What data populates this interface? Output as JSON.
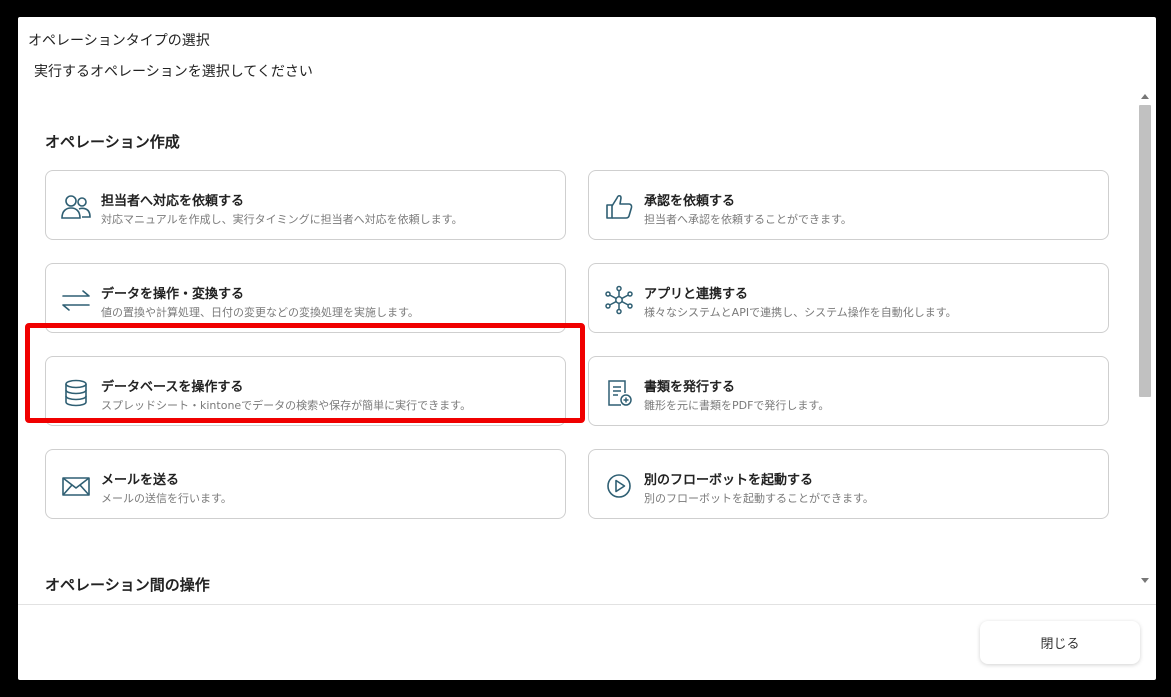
{
  "dialog": {
    "title": "オペレーションタイプの選択",
    "subtitle": "実行するオペレーションを選択してください",
    "close_label": "閉じる"
  },
  "sections": [
    {
      "title": "オペレーション作成",
      "cards": [
        {
          "icon": "people-icon",
          "title": "担当者へ対応を依頼する",
          "desc": "対応マニュアルを作成し、実行タイミングに担当者へ対応を依頼します。"
        },
        {
          "icon": "thumbs-up-icon",
          "title": "承認を依頼する",
          "desc": "担当者へ承認を依頼することができます。"
        },
        {
          "icon": "arrows-exchange-icon",
          "title": "データを操作・変換する",
          "desc": "値の置換や計算処理、日付の変更などの変換処理を実施します。"
        },
        {
          "icon": "network-hub-icon",
          "title": "アプリと連携する",
          "desc": "様々なシステムとAPIで連携し、システム操作を自動化します。"
        },
        {
          "icon": "database-icon",
          "title": "データベースを操作する",
          "desc": "スプレッドシート・kintoneでデータの検索や保存が簡単に実行できます。"
        },
        {
          "icon": "document-add-icon",
          "title": "書類を発行する",
          "desc": "雛形を元に書類をPDFで発行します。"
        },
        {
          "icon": "envelope-icon",
          "title": "メールを送る",
          "desc": "メールの送信を行います。"
        },
        {
          "icon": "play-circle-icon",
          "title": "別のフローボットを起動する",
          "desc": "別のフローボットを起動することができます。"
        }
      ]
    },
    {
      "title": "オペレーション間の操作"
    }
  ],
  "colors": {
    "icon": "#2f5f73",
    "highlight": "#f00000",
    "card_border": "#cfcfcf"
  }
}
